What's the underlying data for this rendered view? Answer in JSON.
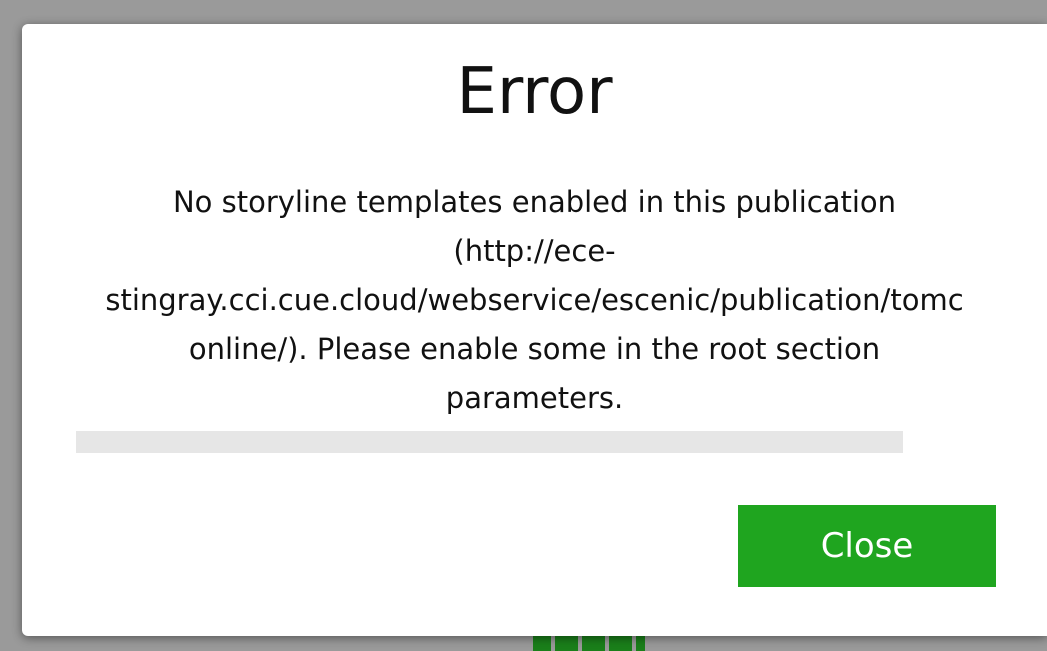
{
  "dialog": {
    "title": "Error",
    "message_lines": [
      "No storyline templates enabled in this publication",
      "(http://ece-",
      "stingray.cci.cue.cloud/webservice/escenic/publication/tomc",
      "online/). Please enable some in the root section",
      "parameters."
    ],
    "close_label": "Close"
  },
  "colors": {
    "button_accent": "#1fa51f",
    "backdrop": "#9a9a9a",
    "progress_track": "#e6e6e6"
  }
}
